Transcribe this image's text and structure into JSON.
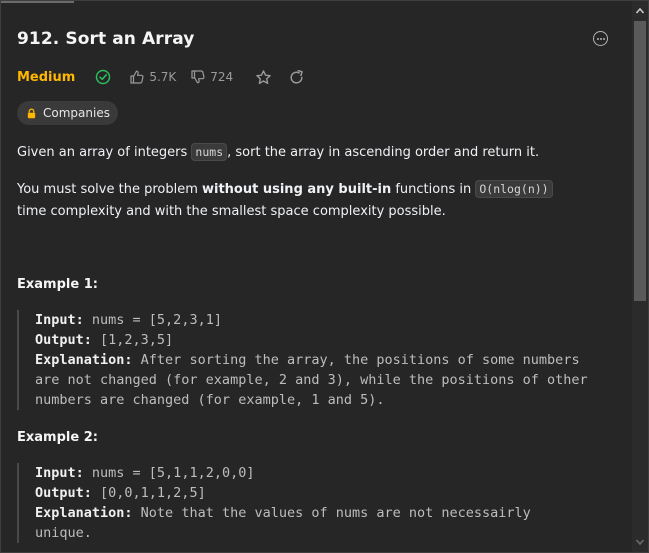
{
  "problem": {
    "title": "912. Sort an Array",
    "difficulty": "Medium",
    "likes": "5.7K",
    "dislikes": "724",
    "companies_label": "Companies"
  },
  "description": {
    "p1_before": "Given an array of integers ",
    "p1_code": "nums",
    "p1_after": ", sort the array in ascending order and return it.",
    "p2_before": "You must solve the problem ",
    "p2_bold": "without using any built-in",
    "p2_middle": " functions in ",
    "p2_code": "O(nlog(n))",
    "p2_after": " time complexity and with the smallest space complexity possible."
  },
  "examples": [
    {
      "title": "Example 1:",
      "input_label": "Input:",
      "input": " nums = [5,2,3,1]",
      "output_label": "Output:",
      "output": " [1,2,3,5]",
      "explanation_label": "Explanation:",
      "explanation_line1": " After sorting the array, the positions of some numbers",
      "explanation_line2": "are not changed (for example, 2 and 3), while the positions of other",
      "explanation_line3": "numbers are changed (for example, 1 and 5)."
    },
    {
      "title": "Example 2:",
      "input_label": "Input:",
      "input": " nums = [5,1,1,2,0,0]",
      "output_label": "Output:",
      "output": " [0,0,1,1,2,5]",
      "explanation_label": "Explanation:",
      "explanation_line1": " Note that the values of nums are not necessairly",
      "explanation_line2": "unique."
    }
  ],
  "colors": {
    "background": "#262626",
    "difficulty_medium": "#ffb800",
    "solved_check": "#2cbb5d",
    "text": "#eff1f6"
  },
  "icons": {
    "solved": "check-circle-icon",
    "like": "thumbs-up-icon",
    "dislike": "thumbs-down-icon",
    "favorite": "star-icon",
    "share": "share-icon",
    "lock": "lock-icon",
    "menu": "more-options-icon"
  }
}
